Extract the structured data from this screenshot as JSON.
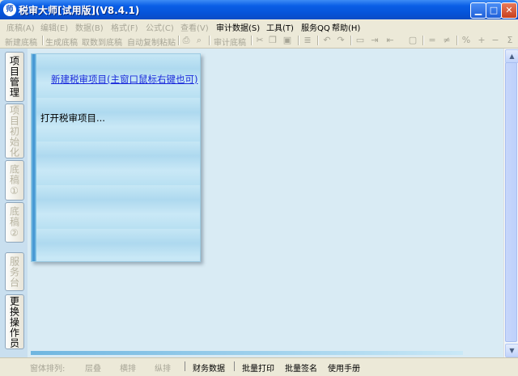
{
  "window": {
    "title": "税审大师[试用版](V8.4.1)",
    "app_icon_text": "师",
    "controls": {
      "minimize": "▁",
      "maximize": "□",
      "close": "✕"
    }
  },
  "menu": [
    {
      "label": "底稿(A)",
      "enabled": false
    },
    {
      "label": "编辑(E)",
      "enabled": false
    },
    {
      "label": "数据(B)",
      "enabled": false
    },
    {
      "label": "格式(F)",
      "enabled": false
    },
    {
      "label": "公式(C)",
      "enabled": false
    },
    {
      "label": "查看(V)",
      "enabled": false
    },
    {
      "label": "审计数据(S)",
      "enabled": true
    },
    {
      "label": "工具(T)",
      "enabled": true
    },
    {
      "label": "服务QQ",
      "enabled": true
    },
    {
      "label": "帮助(H)",
      "enabled": true
    }
  ],
  "toolbar": {
    "new_draft": "新建底稿",
    "generate_draft": "生成底稿",
    "fetch_to_draft": "取数到底稿",
    "auto_copy_paste": "自动复制粘贴",
    "audit_draft": "审计底稿",
    "icons": [
      "print-icon",
      "preview-icon",
      "cut-icon",
      "copy-icon",
      "paste-icon",
      "list-icon",
      "undo-icon",
      "redo-icon",
      "align-icon",
      "indent-icon",
      "outdent-icon",
      "border-icon",
      "equals-icon",
      "not-equal-icon",
      "percent-icon",
      "plus-icon",
      "minus-icon",
      "sum-icon"
    ]
  },
  "left_tabs": [
    {
      "label": "项目管理",
      "enabled": true
    },
    {
      "label": "项目初始化",
      "enabled": false
    },
    {
      "label": "底稿①",
      "enabled": false
    },
    {
      "label": "底稿②",
      "enabled": false
    },
    {
      "label": "服务台",
      "enabled": false
    },
    {
      "label": "更换操作员",
      "enabled": true
    }
  ],
  "panel": {
    "new_project": "新建税审项目(主窗口鼠标右键也可)",
    "open_project": "打开税审项目..."
  },
  "statusbar": {
    "arrange_label": "窗体排列:",
    "cascade": "层叠",
    "tile_horizontal": "横排",
    "tile_vertical": "纵排",
    "financial_data": "财务数据",
    "batch_print": "批量打印",
    "batch_sign": "批量签名",
    "manual": "使用手册"
  }
}
